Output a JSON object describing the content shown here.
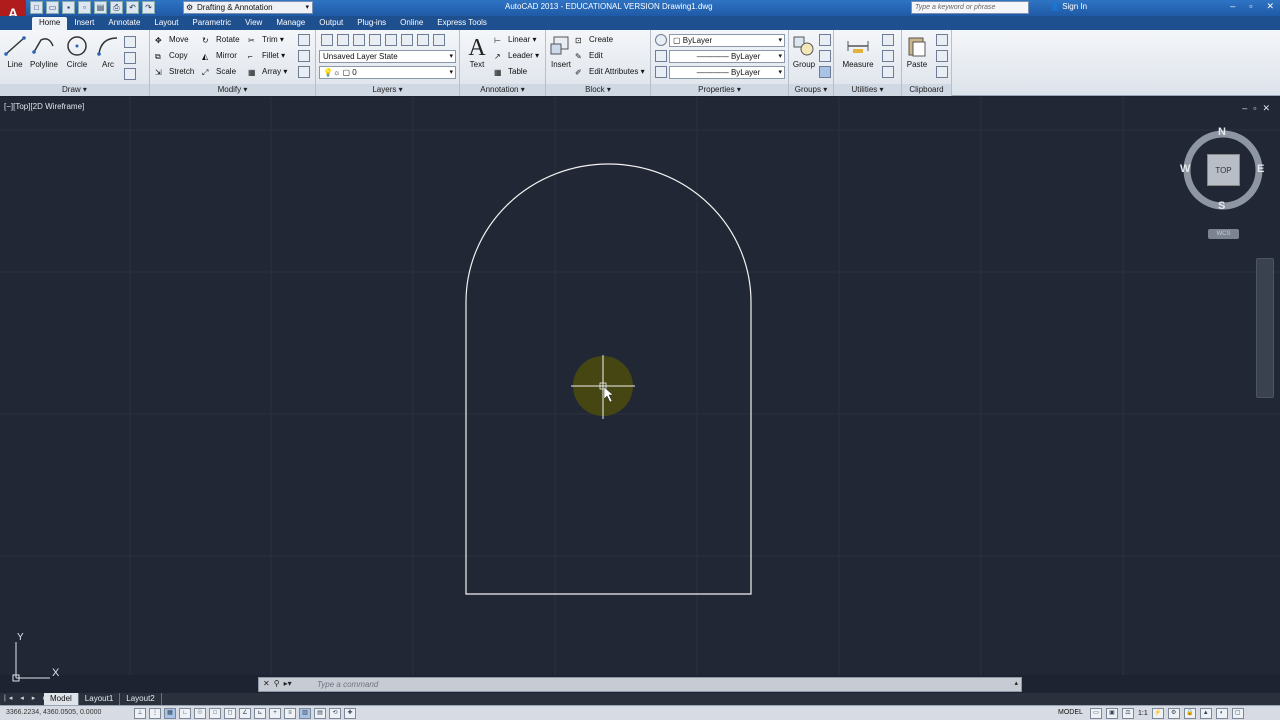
{
  "app": {
    "logo": "A",
    "title": "AutoCAD 2013 - EDUCATIONAL VERSION    Drawing1.dwg",
    "workspace": "Drafting & Annotation",
    "search_placeholder": "Type a keyword or phrase",
    "sign_in": "Sign In"
  },
  "tabs": [
    "Home",
    "Insert",
    "Annotate",
    "Layout",
    "Parametric",
    "View",
    "Manage",
    "Output",
    "Plug-ins",
    "Online",
    "Express Tools"
  ],
  "ribbon": {
    "draw": {
      "title": "Draw",
      "line": "Line",
      "polyline": "Polyline",
      "circle": "Circle",
      "arc": "Arc"
    },
    "modify": {
      "title": "Modify",
      "move": "Move",
      "rotate": "Rotate",
      "trim": "Trim",
      "copy": "Copy",
      "mirror": "Mirror",
      "fillet": "Fillet",
      "stretch": "Stretch",
      "scale": "Scale",
      "array": "Array"
    },
    "layers": {
      "title": "Layers",
      "layer_state": "Unsaved Layer State",
      "current_layer": "0"
    },
    "annotation": {
      "title": "Annotation",
      "text": "Text",
      "linear": "Linear",
      "leader": "Leader",
      "table": "Table"
    },
    "block": {
      "title": "Block",
      "insert": "Insert",
      "create": "Create",
      "edit": "Edit",
      "edit_attributes": "Edit Attributes"
    },
    "properties": {
      "title": "Properties",
      "color": "ByLayer",
      "linetype": "ByLayer",
      "lineweight": "ByLayer"
    },
    "groups": {
      "title": "Groups",
      "group": "Group"
    },
    "utilities": {
      "title": "Utilities",
      "measure": "Measure"
    },
    "clipboard": {
      "title": "Clipboard",
      "paste": "Paste"
    }
  },
  "viewport": {
    "label": "[−][Top][2D Wireframe]",
    "viewcube": {
      "top": "TOP",
      "north": "N",
      "south": "S",
      "east": "E",
      "west": "W",
      "wcs": "WCS"
    }
  },
  "ucs": {
    "x": "X",
    "y": "Y"
  },
  "command": {
    "placeholder": "Type a command"
  },
  "layout_tabs": [
    "Model",
    "Layout1",
    "Layout2"
  ],
  "status": {
    "coordinates": "3366.2234, 4360.0505, 0.0000",
    "model": "MODEL",
    "scale": "1:1"
  }
}
